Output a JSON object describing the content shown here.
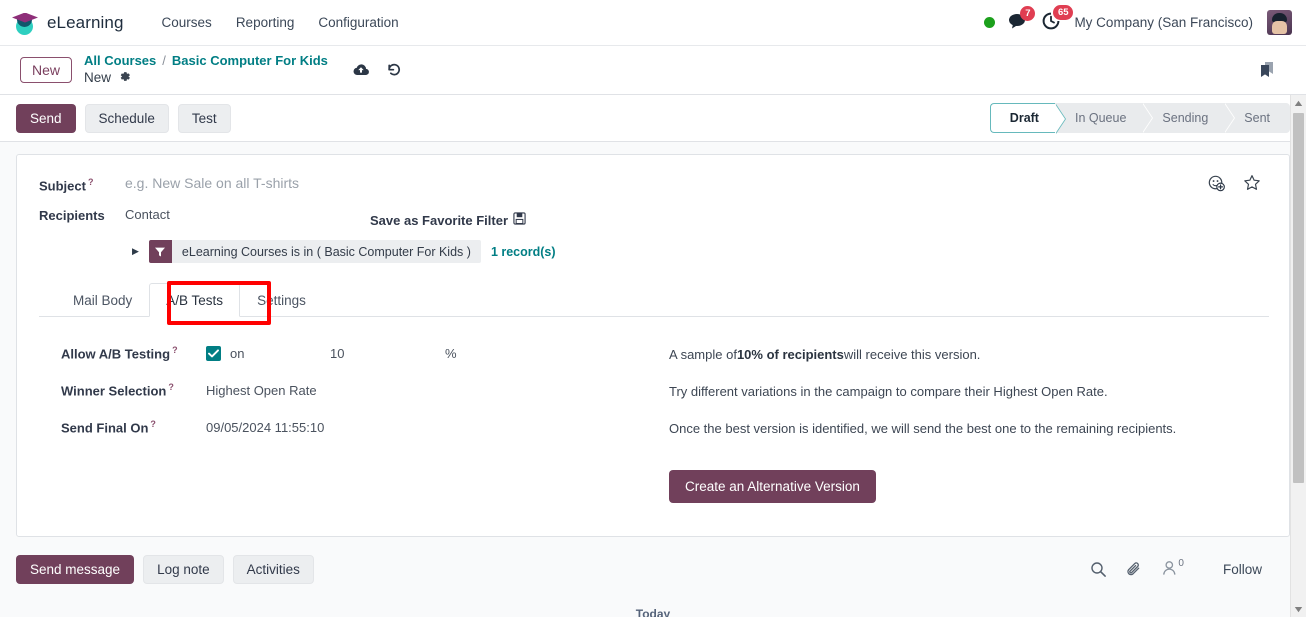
{
  "navbar": {
    "brand": "eLearning",
    "logo_icon": "graduation-cap-icon",
    "menus": [
      {
        "label": "Courses"
      },
      {
        "label": "Reporting"
      },
      {
        "label": "Configuration"
      }
    ],
    "online_indicator": "online-dot-icon",
    "messages": {
      "icon": "messages-icon",
      "count": "7"
    },
    "activities": {
      "icon": "activity-clock-icon",
      "count": "65"
    },
    "company": "My Company (San Francisco)",
    "avatar": "user-avatar"
  },
  "breadcrumb": {
    "new_badge": "New",
    "parent": "All Courses",
    "separator": "/",
    "record": "Basic Computer For Kids",
    "current": "New",
    "gear_icon": "gear-icon",
    "save_icon": "cloud-save-icon",
    "discard_icon": "discard-undo-icon",
    "bookmark_icon": "bookmark-icon"
  },
  "control_panel": {
    "buttons": [
      {
        "label": "Send",
        "style": "primary"
      },
      {
        "label": "Schedule",
        "style": "secondary"
      },
      {
        "label": "Test",
        "style": "secondary"
      }
    ],
    "status_stages": [
      {
        "label": "Draft",
        "active": true
      },
      {
        "label": "In Queue",
        "active": false
      },
      {
        "label": "Sending",
        "active": false
      },
      {
        "label": "Sent",
        "active": false
      }
    ]
  },
  "form": {
    "subject": {
      "label": "Subject",
      "help": "?",
      "value": "",
      "placeholder": "e.g. New Sale on all T-shirts",
      "emoji_icon": "add-emoji-icon",
      "favorite_icon": "star-icon"
    },
    "recipients": {
      "label": "Recipients",
      "value": "Contact",
      "save_favorite_filter": "Save as Favorite Filter",
      "save_filter_icon": "floppy-save-icon",
      "expand_icon": "caret-right-icon",
      "filter_icon": "funnel-filter-icon",
      "filter_text": "eLearning Courses is in ( Basic Computer For Kids )",
      "record_count": "1 record(s)"
    }
  },
  "notebook": {
    "tabs": [
      {
        "label": "Mail Body",
        "active": false,
        "highlighted": false
      },
      {
        "label": "A/B Tests",
        "active": true,
        "highlighted": true
      },
      {
        "label": "Settings",
        "active": false,
        "highlighted": false
      }
    ],
    "highlight_color": "#ff0000"
  },
  "ab_tests": {
    "rows": [
      {
        "label": "Allow A/B Testing",
        "help": "?",
        "checkbox_icon": "checkbox-checked-icon",
        "checkbox_label": "on",
        "percent_value": "10",
        "percent_unit": "%",
        "description_pre": "A sample of ",
        "description_bold": "10% of recipients",
        "description_post": " will receive this version."
      },
      {
        "label": "Winner Selection",
        "help": "?",
        "value": "Highest Open Rate",
        "description": "Try different variations in the campaign to compare their Highest Open Rate."
      },
      {
        "label": "Send Final On",
        "help": "?",
        "value": "09/05/2024 11:55:10",
        "description": "Once the best version is identified, we will send the best one to the remaining recipients."
      }
    ],
    "create_button": "Create an Alternative Version"
  },
  "chatter": {
    "buttons": [
      {
        "label": "Send message",
        "style": "primary"
      },
      {
        "label": "Log note",
        "style": "secondary"
      },
      {
        "label": "Activities",
        "style": "secondary"
      }
    ],
    "search_icon": "search-icon",
    "attachment_icon": "paperclip-icon",
    "followers_icon": "followers-person-icon",
    "followers_count": "0",
    "follow_label": "Follow",
    "cut_off_text": "Today"
  },
  "colors": {
    "primary": "#71405b",
    "accent_teal": "#017e84",
    "badge_red": "#e03e52",
    "highlight_red": "#ff0000",
    "online_green": "#1ca01c"
  }
}
